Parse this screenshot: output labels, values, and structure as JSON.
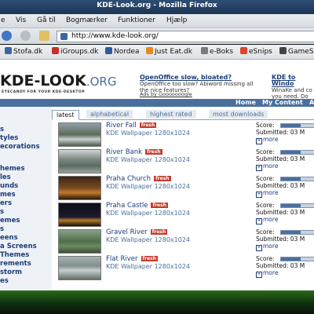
{
  "window": {
    "title": "KDE-Look.org - Mozilla Firefox"
  },
  "menu": [
    "e",
    "Vis",
    "Gå til",
    "Bogmærker",
    "Funktioner",
    "Hjælp"
  ],
  "address": {
    "url": "http://www.kde-look.org/"
  },
  "bookmarks": [
    {
      "label": "Stofa.dk",
      "color": "#3a66a8"
    },
    {
      "label": "iGroups.dk",
      "color": "#c9302c"
    },
    {
      "label": "Nordea",
      "color": "#2b5aa0"
    },
    {
      "label": "Just Eat.dk",
      "color": "#e38a17"
    },
    {
      "label": "e-Boks",
      "color": "#7a7a7a"
    },
    {
      "label": "eSnips",
      "color": "#d9452b"
    },
    {
      "label": "GameSp",
      "color": "#444444"
    }
  ],
  "site": {
    "logo": "KDE-LOOK",
    "logo_suffix": ".ORG",
    "tagline": "EYECANDY FOR YOUR KDE-DESKTOP",
    "ad1_title": "OpenOffice slow, bloated?",
    "ad1_text": "OpenOffice too slow? Abiword missing all the nice features?",
    "ad2_title": "KDE to Windo",
    "ad2_text": "WinaKe and co you need. Do",
    "ads_by": "Ads by Gooooooogle",
    "nav": [
      "Home",
      "My Content",
      "A"
    ]
  },
  "sidebar": [
    "s",
    "tyles",
    "ecorations",
    "hemes",
    "les",
    "unds",
    "mes",
    "ers",
    "s",
    "emes",
    "s",
    "eens",
    "a Screens",
    "Themes",
    "rements",
    "storm",
    "es"
  ],
  "tabs": [
    "latest",
    "alphabetical",
    "highest rated",
    "most downloads"
  ],
  "items": [
    {
      "title": "River Fall",
      "badge": "fresh",
      "sub": "KDE Wallpaper 1280x1024",
      "score_label": "Score:",
      "submitted": "Submitted: 03 M",
      "more": "more",
      "score": 0.55
    },
    {
      "title": "River Bank",
      "badge": "fresh",
      "sub": "KDE Wallpaper 1280x1024",
      "score_label": "Score:",
      "submitted": "Submitted: 03 M",
      "more": "more",
      "score": 0.55
    },
    {
      "title": "Praha Church",
      "badge": "fresh",
      "sub": "KDE Wallpaper 1280x1024",
      "score_label": "Score:",
      "submitted": "Submitted: 03 M",
      "more": "more",
      "score": 0.55
    },
    {
      "title": "Praha Castle",
      "badge": "fresh",
      "sub": "KDE Wallpaper 1280x1024",
      "score_label": "Score:",
      "submitted": "Submitted: 03 M",
      "more": "more",
      "score": 0.55
    },
    {
      "title": "Gravel River",
      "badge": "fresh",
      "sub": "KDE Wallpaper 1280x1024",
      "score_label": "Score:",
      "submitted": "Submitted: 03 M",
      "more": "more",
      "score": 0.55
    },
    {
      "title": "Flat River",
      "badge": "fresh",
      "sub": "KDE Wallpaper 1280x1024",
      "score_label": "Score:",
      "submitted": "Submitted: 03 M",
      "more": "more",
      "score": 0.55
    }
  ]
}
